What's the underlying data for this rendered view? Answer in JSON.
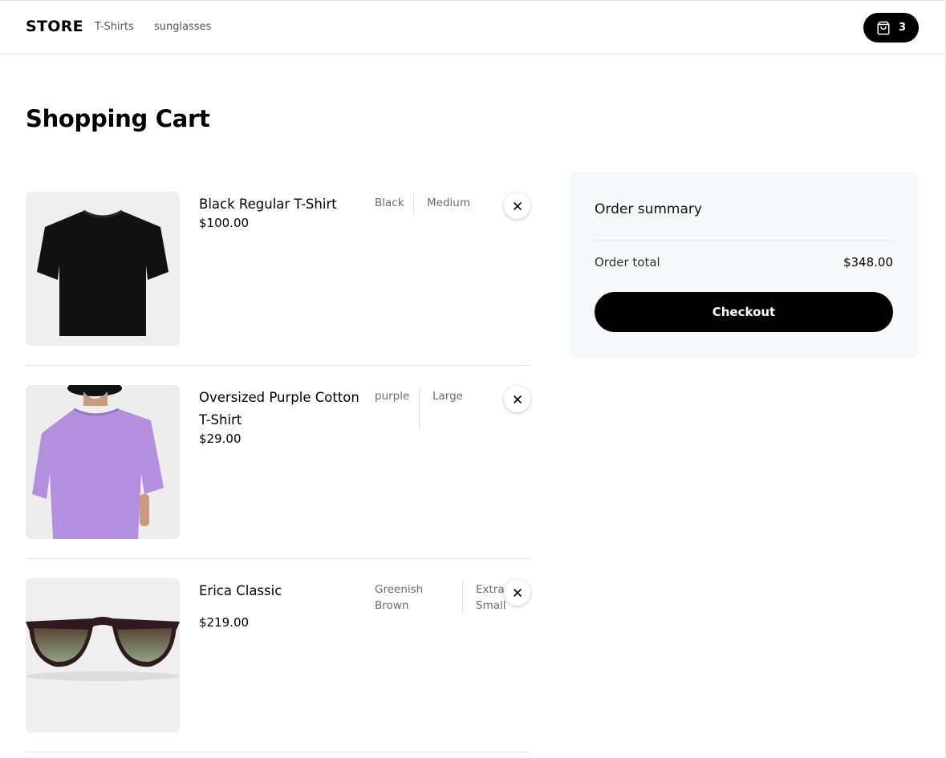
{
  "nav": {
    "logo": "STORE",
    "links": [
      "T-Shirts",
      "sunglasses"
    ],
    "cart_count": "3"
  },
  "page": {
    "title": "Shopping Cart"
  },
  "cart": {
    "items": [
      {
        "name": "Black Regular T-Shirt",
        "price": "$100.00",
        "color": "Black",
        "size": "Medium"
      },
      {
        "name": "Oversized Purple Cotton T-Shirt",
        "price": "$29.00",
        "color": "purple",
        "size": "Large"
      },
      {
        "name": "Erica Classic",
        "price": "$219.00",
        "color": "Greenish Brown",
        "size": "Extra Small"
      }
    ]
  },
  "summary": {
    "title": "Order summary",
    "total_label": "Order total",
    "total_value": "$348.00",
    "checkout_label": "Checkout"
  },
  "colors": {
    "accent": "#000000",
    "summary_bg": "#f7f8fa",
    "product_bg": "#efefef",
    "purple_shirt": "#b48fe0"
  },
  "icons": {
    "cart": "shopping-bag-icon",
    "remove": "close-icon"
  }
}
